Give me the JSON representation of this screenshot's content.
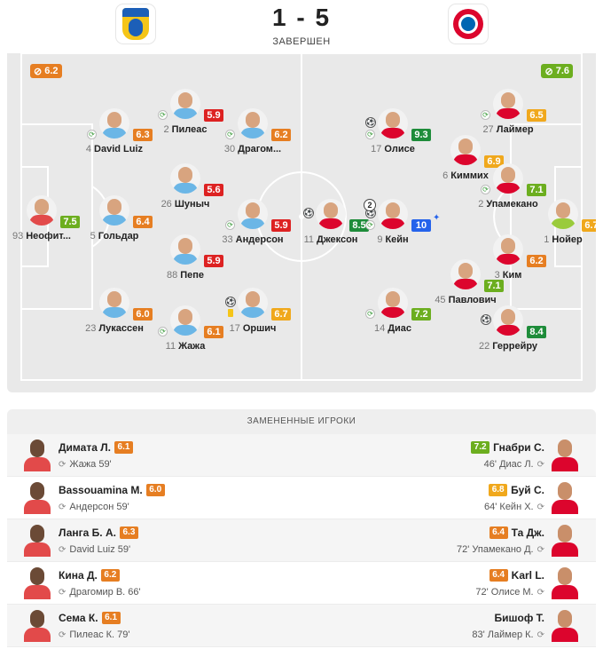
{
  "match": {
    "score": "1 - 5",
    "status": "ЗАВЕРШЕН",
    "home_logo": "pafos-crest-icon",
    "away_logo": "bayern-crest-icon"
  },
  "pitch": {
    "home_team_rating": "6.2",
    "away_team_rating": "7.6",
    "players": [
      {
        "id": "neofytos",
        "side": "home",
        "gk": true,
        "num": "93",
        "name": "Неофит...",
        "rating": "7.5",
        "rc": "r-lgreen"
      },
      {
        "id": "goldar",
        "side": "home",
        "num": "5",
        "name": "Гольдар",
        "rating": "6.4",
        "rc": "r-orange"
      },
      {
        "id": "david-luiz",
        "side": "home",
        "num": "4",
        "name": "David Luiz",
        "rating": "6.3",
        "rc": "r-orange",
        "sub": true
      },
      {
        "id": "lukassen",
        "side": "home",
        "num": "23",
        "name": "Лукассен",
        "rating": "6.0",
        "rc": "r-orange"
      },
      {
        "id": "pileas",
        "side": "home",
        "num": "2",
        "name": "Пилеас",
        "rating": "5.9",
        "rc": "r-red",
        "sub": true
      },
      {
        "id": "shunich",
        "side": "home",
        "num": "26",
        "name": "Шуныч",
        "rating": "5.6",
        "rc": "r-red"
      },
      {
        "id": "pepe",
        "side": "home",
        "num": "88",
        "name": "Пепе",
        "rating": "5.9",
        "rc": "r-red"
      },
      {
        "id": "zhazha",
        "side": "home",
        "num": "11",
        "name": "Жажа",
        "rating": "6.1",
        "rc": "r-orange",
        "sub": true
      },
      {
        "id": "dragomir",
        "side": "home",
        "num": "30",
        "name": "Драгом...",
        "rating": "6.2",
        "rc": "r-orange",
        "sub": true
      },
      {
        "id": "anderson",
        "side": "home",
        "num": "33",
        "name": "Андерсон",
        "rating": "5.9",
        "rc": "r-red",
        "sub": true
      },
      {
        "id": "orshich",
        "side": "home",
        "num": "17",
        "name": "Оршич",
        "rating": "6.7",
        "rc": "r-yellow",
        "goal": true,
        "card": true
      },
      {
        "id": "jackson",
        "side": "away",
        "num": "11",
        "name": "Джексон",
        "rating": "8.5",
        "rc": "r-dgreen",
        "goal": true
      },
      {
        "id": "olise",
        "side": "away",
        "num": "17",
        "name": "Олисе",
        "rating": "9.3",
        "rc": "r-dgreen",
        "goal": true,
        "sub": true
      },
      {
        "id": "kane",
        "side": "away",
        "num": "9",
        "name": "Кейн",
        "rating": "10",
        "rc": "r-blue",
        "goal": true,
        "goals": "2",
        "sub": true,
        "star": true
      },
      {
        "id": "dias",
        "side": "away",
        "num": "14",
        "name": "Диас",
        "rating": "7.2",
        "rc": "r-lgreen",
        "sub": true
      },
      {
        "id": "kimmich",
        "side": "away",
        "num": "6",
        "name": "Киммих",
        "rating": "6.9",
        "rc": "r-yellow"
      },
      {
        "id": "pavlovic",
        "side": "away",
        "num": "45",
        "name": "Павлович",
        "rating": "7.1",
        "rc": "r-lgreen"
      },
      {
        "id": "laimer",
        "side": "away",
        "num": "27",
        "name": "Лаймер",
        "rating": "6.5",
        "rc": "r-yellow",
        "sub": true
      },
      {
        "id": "upamecano",
        "side": "away",
        "num": "2",
        "name": "Упамекано",
        "rating": "7.1",
        "rc": "r-lgreen",
        "sub": true
      },
      {
        "id": "kim",
        "side": "away",
        "num": "3",
        "name": "Ким",
        "rating": "6.2",
        "rc": "r-orange"
      },
      {
        "id": "guerreiro",
        "side": "away",
        "num": "22",
        "name": "Геррейру",
        "rating": "8.4",
        "rc": "r-dgreen",
        "goal": true
      },
      {
        "id": "neuer",
        "side": "away",
        "gk": true,
        "num": "1",
        "name": "Нойер",
        "rating": "6.7",
        "rc": "r-yellow"
      }
    ]
  },
  "subs": {
    "title": "ЗАМЕНЕННЫЕ ИГРОКИ",
    "rows": [
      {
        "home_name": "Димата Л.",
        "home_rating": "6.1",
        "home_rc": "r-orange",
        "home_detail": "Жажа 59'",
        "away_name": "Гнабри С.",
        "away_rating": "7.2",
        "away_rc": "r-lgreen",
        "away_detail": "46' Диас Л."
      },
      {
        "home_name": "Bassouamina M.",
        "home_rating": "6.0",
        "home_rc": "r-orange",
        "home_detail": "Андерсон 59'",
        "away_name": "Буй С.",
        "away_rating": "6.8",
        "away_rc": "r-yellow",
        "away_detail": "64' Кейн Х."
      },
      {
        "home_name": "Ланга Б. А.",
        "home_rating": "6.3",
        "home_rc": "r-orange",
        "home_detail": "David Luiz 59'",
        "away_name": "Та Дж.",
        "away_rating": "6.4",
        "away_rc": "r-orange",
        "away_detail": "72' Упамекано Д."
      },
      {
        "home_name": "Кина Д.",
        "home_rating": "6.2",
        "home_rc": "r-orange",
        "home_detail": "Драгомир В. 66'",
        "away_name": "Karl L.",
        "away_rating": "6.4",
        "away_rc": "r-orange",
        "away_detail": "72' Олисе М."
      },
      {
        "home_name": "Сема К.",
        "home_rating": "6.1",
        "home_rc": "r-orange",
        "home_detail": "Пилеас К. 79'",
        "away_name": "Бишоф Т.",
        "away_rating": "",
        "away_rc": "",
        "away_detail": "83' Лаймер К."
      }
    ]
  }
}
